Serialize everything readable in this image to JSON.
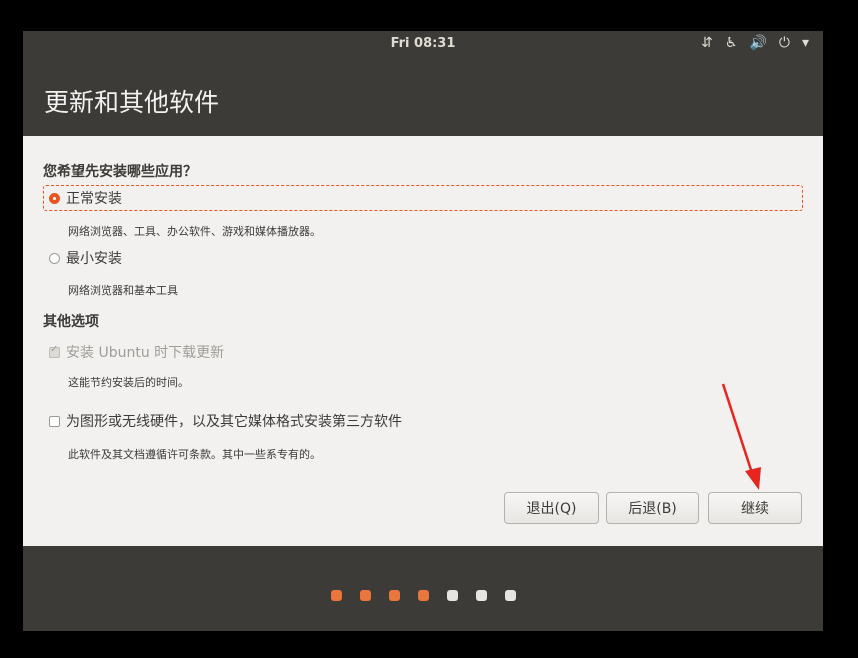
{
  "topbar": {
    "clock": "Fri 08:31"
  },
  "header": {
    "title": "更新和其他软件"
  },
  "question": "您希望先安装哪些应用？",
  "install_options": [
    {
      "label": "正常安装",
      "description": "网络浏览器、工具、办公软件、游戏和媒体播放器。",
      "selected": true
    },
    {
      "label": "最小安装",
      "description": "网络浏览器和基本工具",
      "selected": false
    }
  ],
  "other_options_title": "其他选项",
  "other_options": [
    {
      "label": "安装 Ubuntu 时下载更新",
      "description": "这能节约安装后的时间。",
      "checked": true,
      "disabled": true
    },
    {
      "label": "为图形或无线硬件，以及其它媒体格式安装第三方软件",
      "description": "此软件及其文档遵循许可条款。其中一些系专有的。",
      "checked": false,
      "disabled": false
    }
  ],
  "buttons": {
    "quit": "退出(Q)",
    "back": "后退(B)",
    "continue": "继续"
  },
  "progress": {
    "total_steps": 7,
    "completed_steps": 4
  },
  "colors": {
    "accent": "#e95420",
    "panel": "#3c3b37",
    "content_bg": "#f2f1f0",
    "annotation_arrow": "#e8241d"
  },
  "icons": [
    "network-icon",
    "accessibility-icon",
    "volume-icon",
    "power-icon",
    "chevron-down-icon"
  ]
}
